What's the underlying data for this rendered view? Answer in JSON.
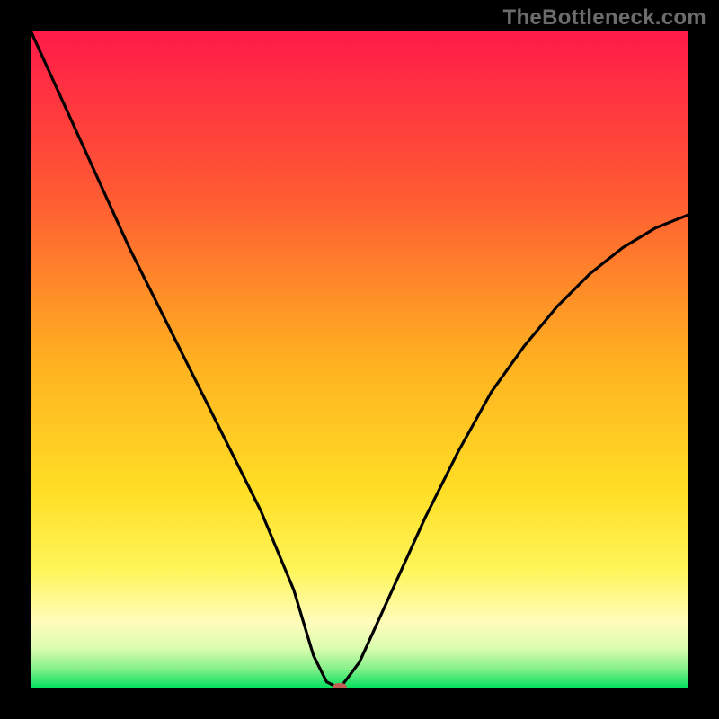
{
  "watermark": "TheBottleneck.com",
  "chart_data": {
    "type": "line",
    "title": "",
    "xlabel": "",
    "ylabel": "",
    "xlim": [
      0,
      100
    ],
    "ylim": [
      0,
      100
    ],
    "grid": false,
    "legend": false,
    "background_gradient": {
      "stops": [
        {
          "pos": 0.0,
          "color": "#ff1a48"
        },
        {
          "pos": 0.25,
          "color": "#ff5a33"
        },
        {
          "pos": 0.5,
          "color": "#ffb020"
        },
        {
          "pos": 0.7,
          "color": "#ffde25"
        },
        {
          "pos": 0.82,
          "color": "#fff55a"
        },
        {
          "pos": 0.9,
          "color": "#fffcbc"
        },
        {
          "pos": 0.94,
          "color": "#d8fcae"
        },
        {
          "pos": 0.97,
          "color": "#86f08a"
        },
        {
          "pos": 1.0,
          "color": "#00e05e"
        }
      ]
    },
    "series": [
      {
        "name": "bottleneck-curve",
        "x": [
          0,
          5,
          10,
          15,
          20,
          25,
          30,
          35,
          40,
          43,
          45,
          47,
          50,
          55,
          60,
          65,
          70,
          75,
          80,
          85,
          90,
          95,
          100
        ],
        "y": [
          100,
          89,
          78,
          67,
          57,
          47,
          37,
          27,
          15,
          5,
          1,
          0,
          4,
          15,
          26,
          36,
          45,
          52,
          58,
          63,
          67,
          70,
          72
        ]
      }
    ],
    "marker": {
      "x": 47,
      "y": 0,
      "color": "#c06055"
    },
    "frame": {
      "outer_border_color": "#000000",
      "outer_border_px": 34
    }
  }
}
